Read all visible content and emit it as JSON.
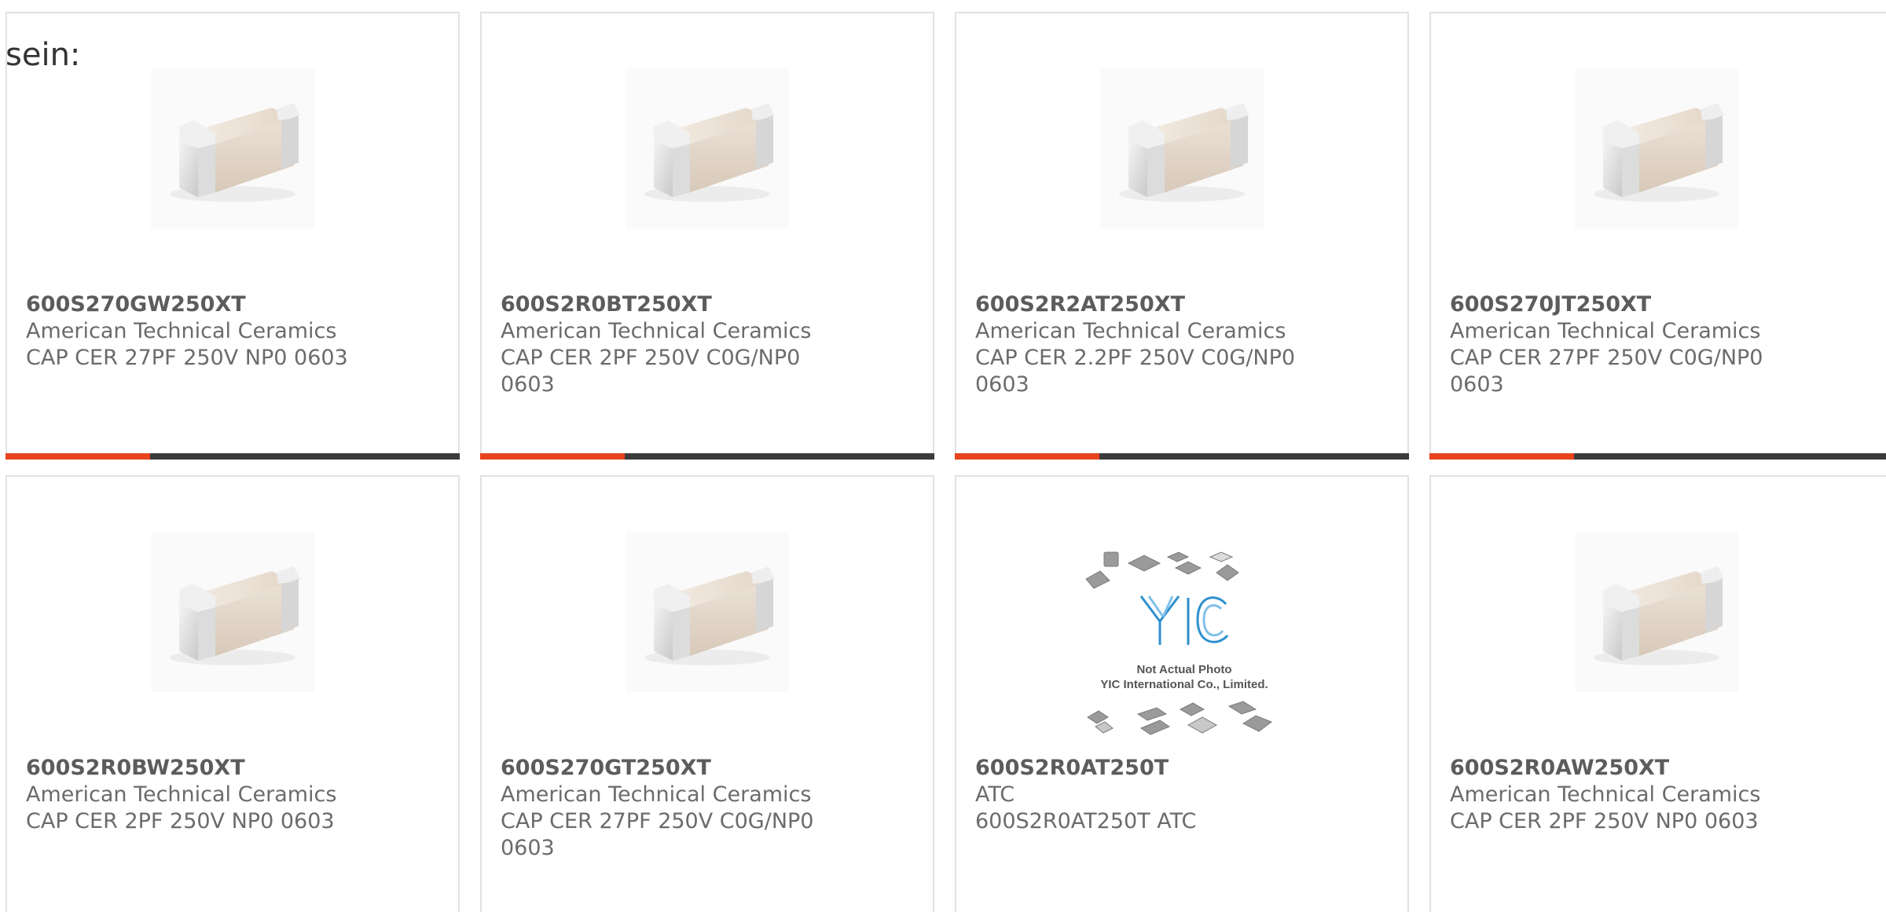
{
  "intro_text": "sein:",
  "accent_color": "#e8431d",
  "track_color": "#3b3b3b",
  "products": [
    {
      "part_number": "600S270GW250XT",
      "manufacturer": "American Technical Ceramics",
      "description": "CAP CER 27PF 250V NP0 0603",
      "image": "capacitor-chip"
    },
    {
      "part_number": "600S2R0BT250XT",
      "manufacturer": "American Technical Ceramics",
      "description": "CAP CER 2PF 250V C0G/NP0 0603",
      "image": "capacitor-chip"
    },
    {
      "part_number": "600S2R2AT250XT",
      "manufacturer": "American Technical Ceramics",
      "description": "CAP CER 2.2PF 250V C0G/NP0 0603",
      "image": "capacitor-chip"
    },
    {
      "part_number": "600S270JT250XT",
      "manufacturer": "American Technical Ceramics",
      "description": "CAP CER 27PF 250V C0G/NP0 0603",
      "image": "capacitor-chip"
    },
    {
      "part_number": "600S2R0BW250XT",
      "manufacturer": "American Technical Ceramics",
      "description": "CAP CER 2PF 250V NP0 0603",
      "image": "capacitor-chip"
    },
    {
      "part_number": "600S270GT250XT",
      "manufacturer": "American Technical Ceramics",
      "description": "CAP CER 27PF 250V C0G/NP0 0603",
      "image": "capacitor-chip"
    },
    {
      "part_number": "600S2R0AT250T",
      "manufacturer": "ATC",
      "description": "600S2R0AT250T ATC",
      "image": "yic-placeholder",
      "placeholder": {
        "logo": "YIC",
        "line1": "Not Actual Photo",
        "line2": "YIC International Co., Limited."
      }
    },
    {
      "part_number": "600S2R0AW250XT",
      "manufacturer": "American Technical Ceramics",
      "description": "CAP CER 2PF 250V NP0 0603",
      "image": "capacitor-chip"
    }
  ]
}
